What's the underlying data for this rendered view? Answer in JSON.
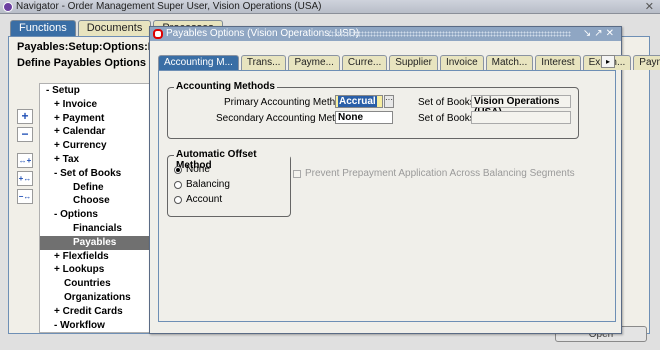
{
  "window": {
    "title": "Navigator - Order Management Super User, Vision Operations (USA)",
    "close_glyph": "✕"
  },
  "navigator": {
    "tabs": [
      {
        "label": "Functions",
        "active": true
      },
      {
        "label": "Documents",
        "active": false
      },
      {
        "label": "Processes",
        "active": false
      }
    ],
    "breadcrumb": "Payables:Setup:Options:Payables",
    "heading": "Define Payables Options",
    "side_buttons": [
      "+",
      "−",
      "↔+",
      "+↔",
      "−↔"
    ],
    "tree": [
      {
        "label": "- Setup",
        "indent": 0
      },
      {
        "label": "+ Invoice",
        "indent": 1
      },
      {
        "label": "+ Payment",
        "indent": 1
      },
      {
        "label": "+ Calendar",
        "indent": 1
      },
      {
        "label": "+ Currency",
        "indent": 1
      },
      {
        "label": "+ Tax",
        "indent": 1
      },
      {
        "label": "- Set of Books",
        "indent": 1
      },
      {
        "label": "Define",
        "indent": 3
      },
      {
        "label": "Choose",
        "indent": 3
      },
      {
        "label": "- Options",
        "indent": 1
      },
      {
        "label": "Financials",
        "indent": 3
      },
      {
        "label": "Payables",
        "indent": 3,
        "selected": true
      },
      {
        "label": "+ Flexfields",
        "indent": 1
      },
      {
        "label": "+ Lookups",
        "indent": 1
      },
      {
        "label": "Countries",
        "indent": 2
      },
      {
        "label": "Organizations",
        "indent": 2
      },
      {
        "label": "+ Credit Cards",
        "indent": 1
      },
      {
        "label": "- Workflow",
        "indent": 1
      }
    ],
    "open_button": "Open"
  },
  "dialog": {
    "title": "Payables Options (Vision Operations: USD)",
    "controls": "↘↗✕",
    "tabs": [
      {
        "label": "Accounting M...",
        "active": true
      },
      {
        "label": "Trans...",
        "active": false
      },
      {
        "label": "Payme...",
        "active": false
      },
      {
        "label": "Curre...",
        "active": false
      },
      {
        "label": "Supplier",
        "active": false
      },
      {
        "label": "Invoice",
        "active": false
      },
      {
        "label": "Match...",
        "active": false
      },
      {
        "label": "Interest",
        "active": false
      },
      {
        "label": "Expen...",
        "active": false
      },
      {
        "label": "Payment",
        "active": false
      }
    ],
    "tab_scroll_glyph": "▸",
    "accounting_methods": {
      "legend": "Accounting Methods",
      "primary_label": "Primary Accounting Method",
      "primary_value": "Accrual",
      "secondary_label": "Secondary Accounting Method",
      "secondary_value": "None",
      "sob_label_1": "Set of Books",
      "sob_value_1": "Vision Operations (USA)",
      "sob_label_2": "Set of Books",
      "sob_value_2": ""
    },
    "offset_method": {
      "legend": "Automatic Offset Method",
      "options": [
        {
          "label": "None",
          "selected": true
        },
        {
          "label": "Balancing",
          "selected": false
        },
        {
          "label": "Account",
          "selected": false
        }
      ]
    },
    "prevent_prepayment": {
      "label": "Prevent Prepayment Application Across Balancing Segments",
      "checked": false
    }
  }
}
